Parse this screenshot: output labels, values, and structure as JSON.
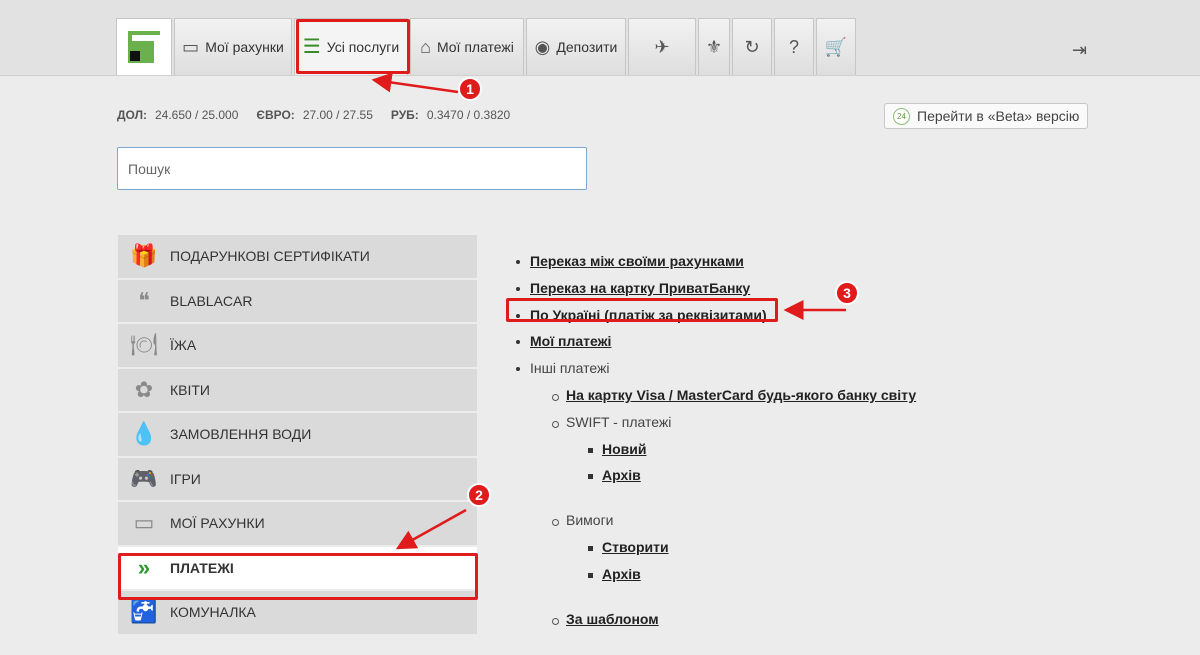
{
  "nav": {
    "items": [
      {
        "icon": "privatbank-logo",
        "label": ""
      },
      {
        "icon": "card-icon",
        "icon_glyph": "▭",
        "label": "Мої рахунки"
      },
      {
        "icon": "list-icon",
        "icon_glyph": "☰",
        "label": "Усі послуги"
      },
      {
        "icon": "house-icon",
        "icon_glyph": "⌂",
        "label": "Мої платежі"
      },
      {
        "icon": "piggy-bank-icon",
        "icon_glyph": "◉",
        "label": "Депозити"
      },
      {
        "icon": "travel-icon",
        "icon_glyph": "✈",
        "label": ""
      },
      {
        "icon": "coat-of-arms-icon",
        "icon_glyph": "⚜",
        "label": ""
      },
      {
        "icon": "history-icon",
        "icon_glyph": "↻",
        "label": ""
      },
      {
        "icon": "help-icon",
        "icon_glyph": "?",
        "label": ""
      },
      {
        "icon": "cart-icon",
        "icon_glyph": "🛒",
        "label": ""
      }
    ],
    "exit_icon": "logout-icon"
  },
  "rates": [
    {
      "label": "ДОЛ:",
      "value": "24.650 / 25.000"
    },
    {
      "label": "ЄВРО:",
      "value": "27.00 / 27.55"
    },
    {
      "label": "РУБ:",
      "value": "0.3470 / 0.3820"
    }
  ],
  "beta": {
    "badge": "24",
    "label": "Перейти в «Beta» версію"
  },
  "search": {
    "placeholder": "Пошук",
    "value": ""
  },
  "side_menu": [
    {
      "icon": "gift-icon",
      "glyph": "🎁",
      "label": "ПОДАРУНКОВІ СЕРТИФІКАТИ"
    },
    {
      "icon": "quote-icon",
      "glyph": "❝",
      "label": "BLABLACAR"
    },
    {
      "icon": "food-icon",
      "glyph": "🍽",
      "label": "ЇЖА"
    },
    {
      "icon": "flower-icon",
      "glyph": "✿",
      "label": "КВІТИ"
    },
    {
      "icon": "water-drop-icon",
      "glyph": "💧",
      "label": "ЗАМОВЛЕННЯ ВОДИ"
    },
    {
      "icon": "gamepad-icon",
      "glyph": "🎮",
      "label": "ІГРИ"
    },
    {
      "icon": "card-icon",
      "glyph": "▭",
      "label": "МОЇ РАХУНКИ"
    },
    {
      "icon": "chevrons-icon",
      "glyph": "»",
      "label": "ПЛАТЕЖІ"
    },
    {
      "icon": "tap-icon",
      "glyph": "🚰",
      "label": "КОМУНАЛКА"
    }
  ],
  "payments": {
    "own_transfer": "Переказ між своїми рахунками",
    "privat_card": "Переказ на картку ПриватБанку",
    "ukraine": "По Україні (платіж за реквізитами)",
    "my_payments": "Мої платежі",
    "other": "Інші платежі",
    "visa": "На картку Visa / MasterCard будь-якого банку світу",
    "swift": "SWIFT - платежі",
    "swift_new": "Новий",
    "swift_archive": "Архів",
    "demands": "Вимоги",
    "demands_create": "Створити",
    "demands_archive": "Архів",
    "by_template": "За шаблоном"
  },
  "annotations": [
    "1",
    "2",
    "3"
  ],
  "colors": {
    "annotation": "#e01b1b",
    "accent": "#2e9a2e"
  }
}
